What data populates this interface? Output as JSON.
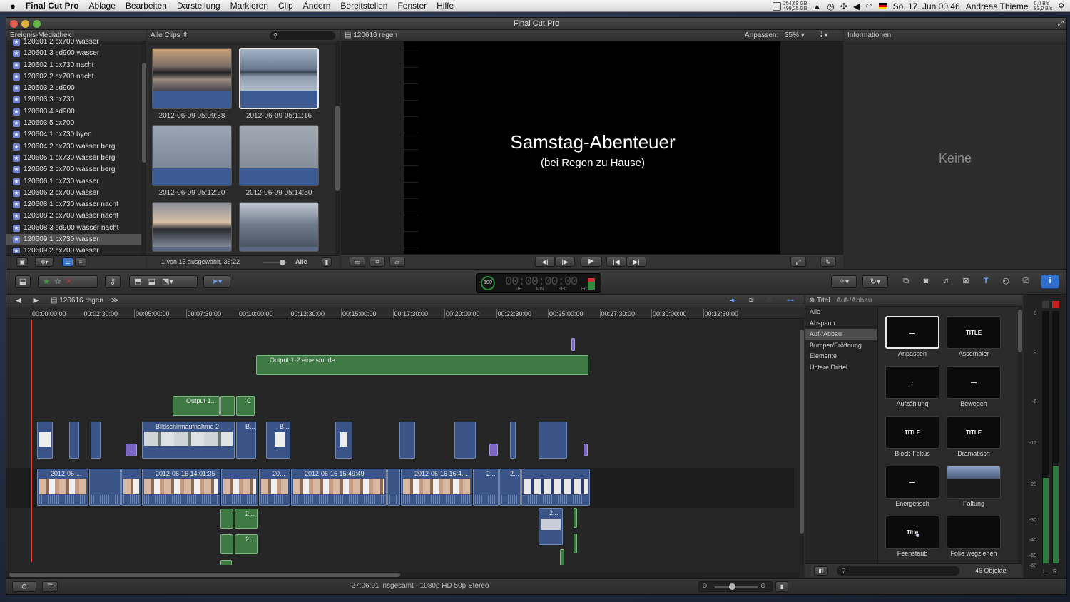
{
  "menubar": {
    "apple": "",
    "app_name": "Final Cut Pro",
    "items": [
      "Ablage",
      "Bearbeiten",
      "Darstellung",
      "Markieren",
      "Clip",
      "Ändern",
      "Bereitstellen",
      "Fenster",
      "Hilfe"
    ],
    "disk1": "254,69 GB",
    "disk2": "499,25 GB",
    "clock": "So. 17. Jun  00:46",
    "user": "Andreas Thieme",
    "net1": "0,0 B/s",
    "net2": "83,0 B/s"
  },
  "window": {
    "title": "Final Cut Pro"
  },
  "library": {
    "header": "Ereignis-Mediathek",
    "items": [
      "120601 2 cx700 wasser",
      "120601 3 sd900 wasser",
      "120602 1 cx730 nacht",
      "120602 2 cx700 nacht",
      "120603 2 sd900",
      "120603 3 cx730",
      "120603 4 sd900",
      "120603 5 cx700",
      "120604 1 cx730 byen",
      "120604 2 cx730 wasser berg",
      "120605 1 cx730 wasser berg",
      "120605 2 cx700 wasser berg",
      "120606 1 cx730 wasser",
      "120606 2 cx700 wasser",
      "120608 1 cx730 wasser nacht",
      "120608 2 cx700 wasser nacht",
      "120608 3 sd900 wasser nacht",
      "120609 1 cx730 wasser",
      "120609 2 cx700 wasser"
    ],
    "selected_index": 17
  },
  "browser": {
    "filter": "Alle Clips",
    "clips": [
      {
        "label": "2012-06-09 05:09:38"
      },
      {
        "label": "2012-06-09 05:11:16"
      },
      {
        "label": "2012-06-09 05:12:20"
      },
      {
        "label": "2012-06-09 05:14:50"
      },
      {
        "label": ""
      },
      {
        "label": ""
      }
    ],
    "status": "1 von 13 ausgewählt, 35:22",
    "filter_bottom": "Alle"
  },
  "viewer": {
    "title": "120616 regen",
    "fit_label": "Anpassen:",
    "zoom": "35%",
    "headline": "Samstag-Abenteuer",
    "subline": "(bei Regen zu Hause)"
  },
  "inspector": {
    "header": "Informationen",
    "empty": "Keine"
  },
  "toolbar": {
    "timecode_rate": "100",
    "timecode": "00:00:00:00",
    "tc_units": [
      "HR",
      "MIN",
      "SEC",
      "FR"
    ]
  },
  "timeline": {
    "project": "120616 regen",
    "ruler": [
      "00:00:00:00",
      "00:02:30:00",
      "00:05:00:00",
      "00:07:30:00",
      "00:10:00:00",
      "00:12:30:00",
      "00:15:00:00",
      "00:17:30:00",
      "00:20:00:00",
      "00:22:30:00",
      "00:25:00:00",
      "00:27:30:00",
      "00:30:00:00",
      "00:32:30:00"
    ],
    "clip_labels": {
      "output_long": "Output 1-2 eine stunde",
      "output_short": "Output 1...",
      "output_c": "C",
      "screen": "Bildschirmaufnahme 2",
      "b1": "B...",
      "b2": "B...",
      "primary1": "2012-06-...",
      "primary2": "2012-06-16 14:01:35",
      "primary3": "20...",
      "primary4": "2012-06-16 15:49:49",
      "primary5": "2012-06-16 16:4...",
      "primary6": "2...",
      "primary7": "2...",
      "g1": "2...",
      "g2": "2...",
      "g3": "2..."
    },
    "status": "27:06:01 insgesamt - 1080p HD 50p Stereo"
  },
  "titles_browser": {
    "header": "Titel",
    "subheader": "Auf-/Abbau",
    "categories": [
      "Alle",
      "Abspann",
      "Auf-/Abbau",
      "Bumper/Eröffnung",
      "Elemente",
      "Untere Drittel"
    ],
    "selected_category": 2,
    "items": [
      {
        "name": "Anpassen",
        "thumb": "—"
      },
      {
        "name": "Assembler",
        "thumb": "TITLE"
      },
      {
        "name": "Aufzählung",
        "thumb": "·"
      },
      {
        "name": "Bewegen",
        "thumb": "—"
      },
      {
        "name": "Block-Fokus",
        "thumb": "TITLE"
      },
      {
        "name": "Dramatisch",
        "thumb": "TITLE"
      },
      {
        "name": "Energetisch",
        "thumb": "—"
      },
      {
        "name": "Faltung",
        "thumb": ""
      },
      {
        "name": "Feenstaub",
        "thumb": "Title"
      },
      {
        "name": "Folie wegziehen",
        "thumb": ""
      }
    ],
    "count": "46 Objekte"
  },
  "meter": {
    "scale": [
      "6",
      "0",
      "-6",
      "-12",
      "-20",
      "-30",
      "-40",
      "-50",
      "-60"
    ],
    "channels": [
      "L",
      "R"
    ]
  },
  "colors": {
    "playhead": "#e8463c",
    "selection": "#e8e8e8",
    "accent": "#3a7bd5"
  }
}
